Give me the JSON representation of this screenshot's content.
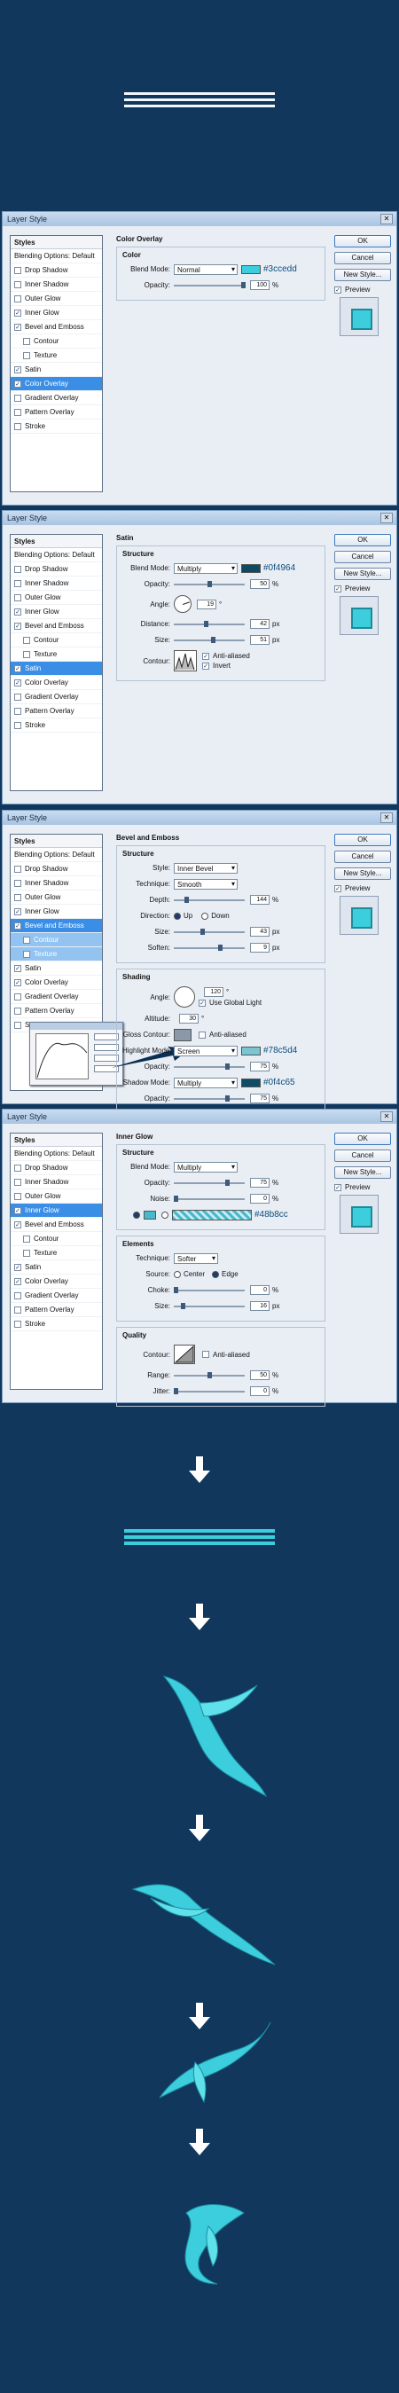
{
  "colors": {
    "bg": "#12375c",
    "cyan": "#3ccedd",
    "stripe": "#e8f2fb",
    "ribbonDark": "#1a8ea0"
  },
  "styles_header": "Styles",
  "blending": "Blending Options: Default",
  "style_items": [
    "Drop Shadow",
    "Inner Shadow",
    "Outer Glow",
    "Inner Glow",
    "Bevel and Emboss",
    "Contour",
    "Texture",
    "Satin",
    "Color Overlay",
    "Gradient Overlay",
    "Pattern Overlay",
    "Stroke"
  ],
  "buttons": {
    "ok": "OK",
    "cancel": "Cancel",
    "new_style": "New Style...",
    "preview": "Preview"
  },
  "dialog_title": "Layer Style",
  "window1": {
    "section": "Color Overlay",
    "legend": "Color",
    "blend_label": "Blend Mode:",
    "blend_value": "Normal",
    "hex": "#3ccedd",
    "opacity_label": "Opacity:",
    "opacity_value": "100",
    "unit": "%"
  },
  "window2": {
    "section": "Satin",
    "legend": "Structure",
    "blend_label": "Blend Mode:",
    "blend_value": "Multiply",
    "hex": "#0f4964",
    "opacity_label": "Opacity:",
    "opacity_value": "50",
    "angle_label": "Angle:",
    "angle_value": "19",
    "distance_label": "Distance:",
    "distance_value": "42",
    "px": "px",
    "size_label": "Size:",
    "size_value": "51",
    "contour_label": "Contour:",
    "antialiased": "Anti-aliased",
    "invert": "Invert"
  },
  "window3": {
    "section": "Bevel and Emboss",
    "legend": "Structure",
    "style_label": "Style:",
    "style_value": "Inner Bevel",
    "technique_label": "Technique:",
    "technique_value": "Smooth",
    "depth_label": "Depth:",
    "depth_value": "144",
    "direction_label": "Direction:",
    "up": "Up",
    "down": "Down",
    "size_label": "Size:",
    "size_value": "43",
    "soften_label": "Soften:",
    "soften_value": "9",
    "shading": "Shading",
    "angle_label": "Angle:",
    "angle_value": "120",
    "global_light": "Use Global Light",
    "altitude_label": "Altitude:",
    "altitude_value": "30",
    "gloss_label": "Gloss Contour:",
    "antialiased": "Anti-aliased",
    "highlight_label": "Highlight Mode:",
    "highlight_value": "Screen",
    "highlight_hex": "#78c5d4",
    "highlight_opacity": "75",
    "shadow_label": "Shadow Mode:",
    "shadow_value": "Multiply",
    "shadow_hex": "#0f4c65",
    "shadow_opacity": "75"
  },
  "window4": {
    "section": "Inner Glow",
    "legend": "Structure",
    "blend_label": "Blend Mode:",
    "blend_value": "Multiply",
    "opacity_label": "Opacity:",
    "opacity_value": "75",
    "noise_label": "Noise:",
    "noise_value": "0",
    "hex": "#48b8cc",
    "elements": "Elements",
    "technique_label": "Technique:",
    "technique_value": "Softer",
    "source_label": "Source:",
    "center": "Center",
    "edge": "Edge",
    "choke_label": "Choke:",
    "choke_value": "0",
    "size_label": "Size:",
    "size_value": "16",
    "quality": "Quality",
    "contour_label": "Contour:",
    "antialiased": "Anti-aliased",
    "range_label": "Range:",
    "range_value": "50",
    "jitter_label": "Jitter:",
    "jitter_value": "0"
  }
}
